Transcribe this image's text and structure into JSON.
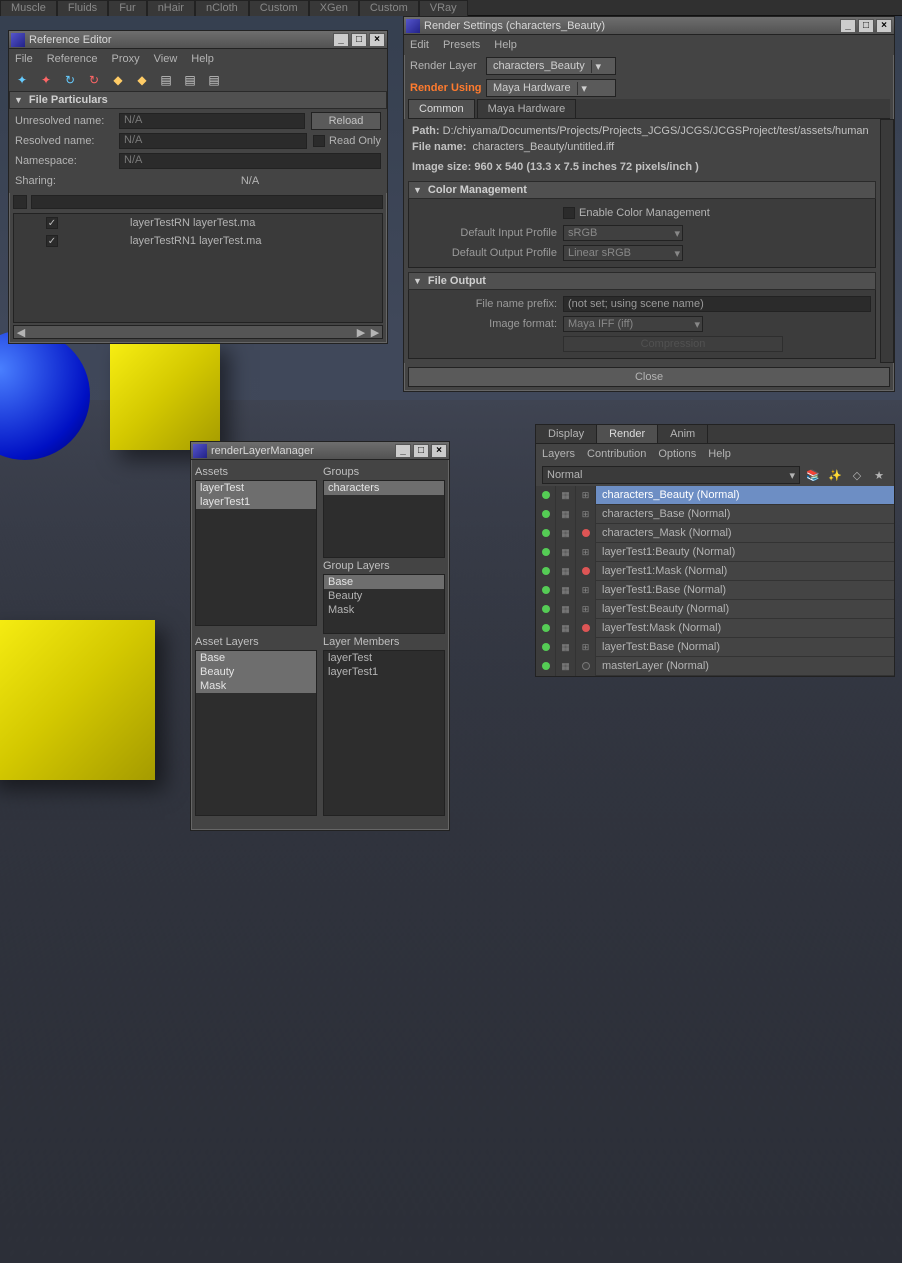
{
  "shelf": [
    "Muscle",
    "Fluids",
    "Fur",
    "nHair",
    "nCloth",
    "Custom",
    "XGen",
    "Custom",
    "VRay"
  ],
  "refEditor": {
    "title": "Reference Editor",
    "menus": [
      "File",
      "Reference",
      "Proxy",
      "View",
      "Help"
    ],
    "section": "File Particulars",
    "rows": {
      "unresolved": "Unresolved name:",
      "resolved": "Resolved name:",
      "namespace": "Namespace:",
      "sharing": "Sharing:"
    },
    "na": "N/A",
    "reload": "Reload",
    "readonly": "Read Only",
    "sharing_val": "N/A",
    "refs": [
      "layerTestRN layerTest.ma",
      "layerTestRN1 layerTest.ma"
    ]
  },
  "rlm": {
    "title": "renderLayerManager",
    "assets_cap": "Assets",
    "groups_cap": "Groups",
    "assets": [
      "layerTest",
      "layerTest1"
    ],
    "groups": [
      "characters"
    ],
    "group_layers_cap": "Group Layers",
    "group_layers": [
      "Base",
      "Beauty",
      "Mask"
    ],
    "asset_layers_cap": "Asset Layers",
    "asset_layers": [
      "Base",
      "Beauty",
      "Mask"
    ],
    "layer_members_cap": "Layer Members",
    "layer_members": [
      "layerTest",
      "layerTest1"
    ]
  },
  "rs": {
    "title": "Render Settings (characters_Beauty)",
    "menus": [
      "Edit",
      "Presets",
      "Help"
    ],
    "render_layer_lbl": "Render Layer",
    "render_layer_val": "characters_Beauty",
    "render_using_lbl": "Render Using",
    "render_using_val": "Maya Hardware",
    "tabs": [
      "Common",
      "Maya Hardware"
    ],
    "path_lbl": "Path:",
    "path_val": "D:/chiyama/Documents/Projects/Projects_JCGS/JCGS/JCGSProject/test/assets/human",
    "file_lbl": "File name:",
    "file_val": "characters_Beauty/untitled.iff",
    "size_info": "Image size: 960 x 540 (13.3 x 7.5 inches 72 pixels/inch )",
    "cm_header": "Color Management",
    "cm_enable": "Enable Color Management",
    "cm_in_lbl": "Default Input Profile",
    "cm_in_val": "sRGB",
    "cm_out_lbl": "Default Output Profile",
    "cm_out_val": "Linear sRGB",
    "fo_header": "File Output",
    "fo_prefix_lbl": "File name prefix:",
    "fo_prefix_val": "(not set; using scene name)",
    "fo_format_lbl": "Image format:",
    "fo_format_val": "Maya IFF (iff)",
    "compression": "Compression",
    "close": "Close"
  },
  "layerEditor": {
    "tabs": [
      "Display",
      "Render",
      "Anim"
    ],
    "menus": [
      "Layers",
      "Contribution",
      "Options",
      "Help"
    ],
    "mode": "Normal",
    "layers": [
      {
        "name": "characters_Beauty (Normal)",
        "type": "beauty",
        "active": true
      },
      {
        "name": "characters_Base (Normal)",
        "type": "base"
      },
      {
        "name": "characters_Mask (Normal)",
        "type": "mask"
      },
      {
        "name": "layerTest1:Beauty (Normal)",
        "type": "beauty"
      },
      {
        "name": "layerTest1:Mask (Normal)",
        "type": "mask"
      },
      {
        "name": "layerTest1:Base (Normal)",
        "type": "base"
      },
      {
        "name": "layerTest:Beauty (Normal)",
        "type": "beauty"
      },
      {
        "name": "layerTest:Mask (Normal)",
        "type": "mask"
      },
      {
        "name": "layerTest:Base (Normal)",
        "type": "base"
      },
      {
        "name": "masterLayer (Normal)",
        "type": "master"
      }
    ]
  }
}
